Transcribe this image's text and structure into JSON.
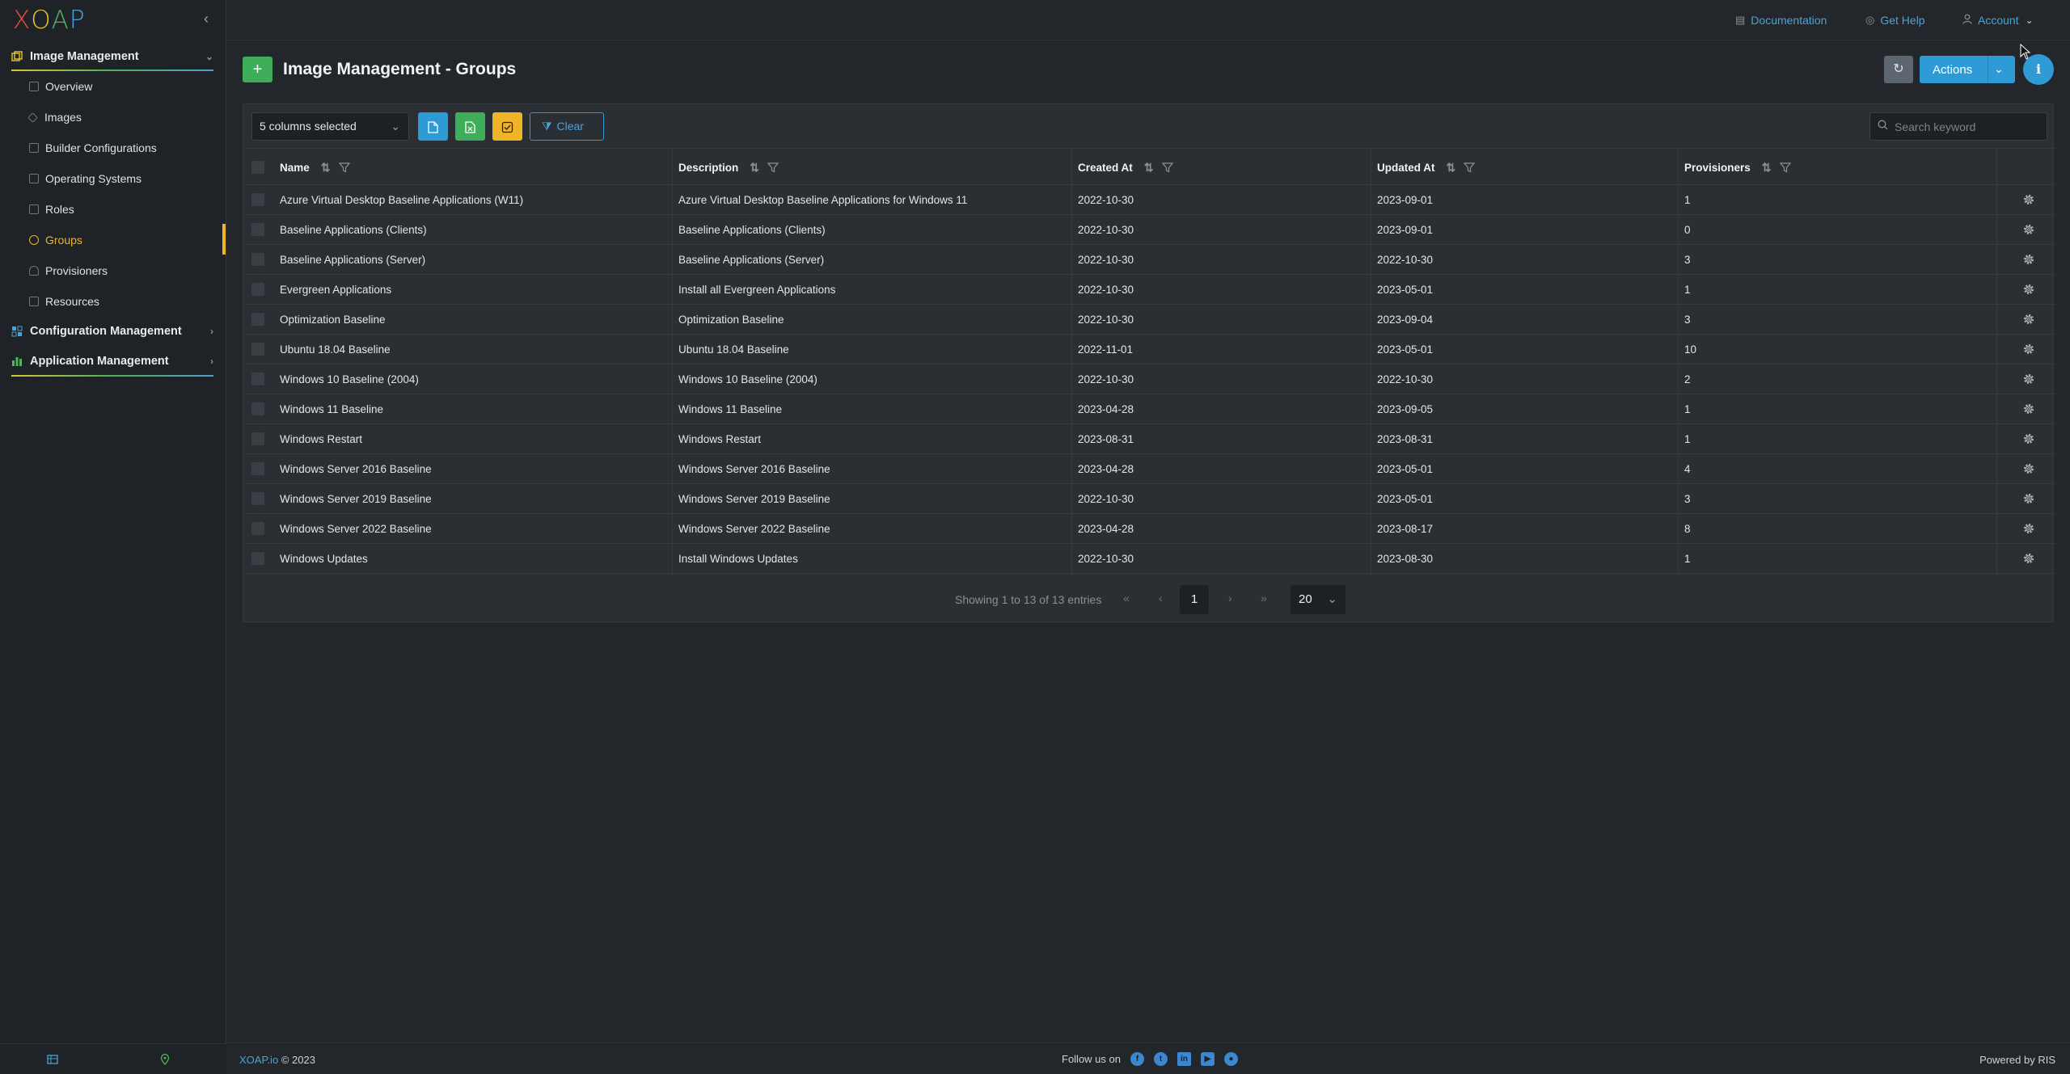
{
  "app": {
    "logo_text": "XOAP"
  },
  "sidebar": {
    "sections": [
      {
        "label": "Image Management",
        "icon": "layers-icon",
        "expanded": true
      },
      {
        "label": "Configuration Management",
        "icon": "grid-icon",
        "expanded": false
      },
      {
        "label": "Application Management",
        "icon": "app-stack-icon",
        "expanded": false
      }
    ],
    "items": [
      {
        "label": "Overview",
        "icon": "overview-icon"
      },
      {
        "label": "Images",
        "icon": "images-icon"
      },
      {
        "label": "Builder Configurations",
        "icon": "builder-icon"
      },
      {
        "label": "Operating Systems",
        "icon": "os-icon"
      },
      {
        "label": "Roles",
        "icon": "roles-icon"
      },
      {
        "label": "Groups",
        "icon": "groups-icon",
        "active": true
      },
      {
        "label": "Provisioners",
        "icon": "provisioners-icon"
      },
      {
        "label": "Resources",
        "icon": "resources-icon"
      }
    ]
  },
  "topbar": {
    "documentation": "Documentation",
    "get_help": "Get Help",
    "account": "Account"
  },
  "page": {
    "title": "Image Management - Groups",
    "actions_label": "Actions"
  },
  "toolbar": {
    "columns_selected": "5 columns selected",
    "clear_label": "Clear",
    "search_placeholder": "Search keyword"
  },
  "table": {
    "columns": [
      "Name",
      "Description",
      "Created At",
      "Updated At",
      "Provisioners"
    ],
    "rows": [
      [
        "Azure Virtual Desktop Baseline Applications (W11)",
        "Azure Virtual Desktop Baseline Applications for Windows 11",
        "2022-10-30",
        "2023-09-01",
        "1"
      ],
      [
        "Baseline Applications (Clients)",
        "Baseline Applications (Clients)",
        "2022-10-30",
        "2023-09-01",
        "0"
      ],
      [
        "Baseline Applications (Server)",
        "Baseline Applications (Server)",
        "2022-10-30",
        "2022-10-30",
        "3"
      ],
      [
        "Evergreen Applications",
        "Install all Evergreen Applications",
        "2022-10-30",
        "2023-05-01",
        "1"
      ],
      [
        "Optimization Baseline",
        "Optimization Baseline",
        "2022-10-30",
        "2023-09-04",
        "3"
      ],
      [
        "Ubuntu 18.04 Baseline",
        "Ubuntu 18.04 Baseline",
        "2022-11-01",
        "2023-05-01",
        "10"
      ],
      [
        "Windows 10 Baseline (2004)",
        "Windows 10 Baseline (2004)",
        "2022-10-30",
        "2022-10-30",
        "2"
      ],
      [
        "Windows 11 Baseline",
        "Windows 11 Baseline",
        "2023-04-28",
        "2023-09-05",
        "1"
      ],
      [
        "Windows Restart",
        "Windows Restart",
        "2023-08-31",
        "2023-08-31",
        "1"
      ],
      [
        "Windows Server 2016 Baseline",
        "Windows Server 2016 Baseline",
        "2023-04-28",
        "2023-05-01",
        "4"
      ],
      [
        "Windows Server 2019 Baseline",
        "Windows Server 2019 Baseline",
        "2022-10-30",
        "2023-05-01",
        "3"
      ],
      [
        "Windows Server 2022 Baseline",
        "Windows Server 2022 Baseline",
        "2023-04-28",
        "2023-08-17",
        "8"
      ],
      [
        "Windows Updates",
        "Install Windows Updates",
        "2022-10-30",
        "2023-08-30",
        "1"
      ]
    ]
  },
  "pagination": {
    "info": "Showing 1 to 13 of 13 entries",
    "current_page": "1",
    "page_size": "20"
  },
  "footer": {
    "brand_link": "XOAP.io",
    "copyright": "© 2023",
    "follow": "Follow us on",
    "social": [
      "facebook-icon",
      "twitter-icon",
      "linkedin-icon",
      "youtube-icon",
      "github-icon"
    ],
    "powered": "Powered by RIS"
  },
  "colors": {
    "accent_blue": "#2e9ad6",
    "active_yellow": "#f0b429",
    "add_green": "#3fae5b",
    "background": "#23272b"
  }
}
